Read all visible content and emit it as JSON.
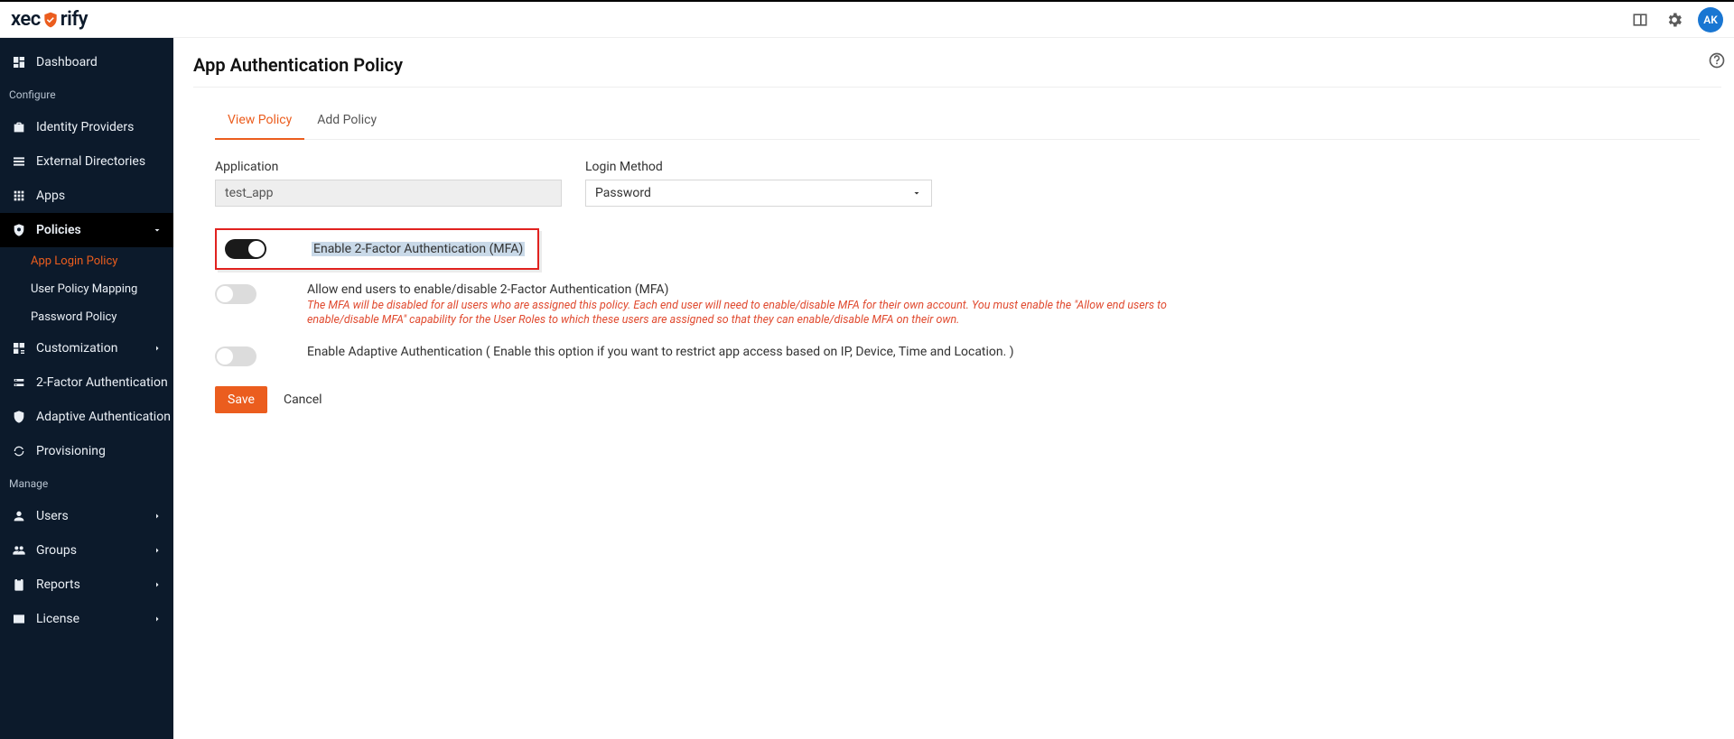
{
  "header": {
    "brand_prefix": "xec",
    "brand_suffix": "rify",
    "avatar_initials": "AK"
  },
  "sidebar": {
    "item_dashboard": "Dashboard",
    "section_configure": "Configure",
    "item_identity_providers": "Identity Providers",
    "item_external_directories": "External Directories",
    "item_apps": "Apps",
    "item_policies": "Policies",
    "sub_app_login_policy": "App Login Policy",
    "sub_user_policy_mapping": "User Policy Mapping",
    "sub_password_policy": "Password Policy",
    "item_customization": "Customization",
    "item_2fa": "2-Factor Authentication",
    "item_adaptive_auth": "Adaptive Authentication",
    "item_provisioning": "Provisioning",
    "section_manage": "Manage",
    "item_users": "Users",
    "item_groups": "Groups",
    "item_reports": "Reports",
    "item_license": "License"
  },
  "page": {
    "title": "App Authentication Policy",
    "tab_view": "View Policy",
    "tab_add": "Add Policy",
    "application_label": "Application",
    "application_value": "test_app",
    "login_method_label": "Login Method",
    "login_method_value": "Password",
    "toggle_mfa_label": "Enable 2-Factor Authentication (MFA)",
    "toggle_allow_label": "Allow end users to enable/disable 2-Factor Authentication (MFA)",
    "toggle_allow_help": "The MFA will be disabled for all users who are assigned this policy. Each end user will need to enable/disable MFA for their own account. You must enable the \"Allow end users to enable/disable MFA\" capability for the User Roles to which these users are assigned so that they can enable/disable MFA on their own.",
    "toggle_adaptive_label": "Enable Adaptive Authentication ( Enable this option if you want to restrict app access based on IP, Device, Time and Location. )",
    "btn_save": "Save",
    "btn_cancel": "Cancel"
  }
}
